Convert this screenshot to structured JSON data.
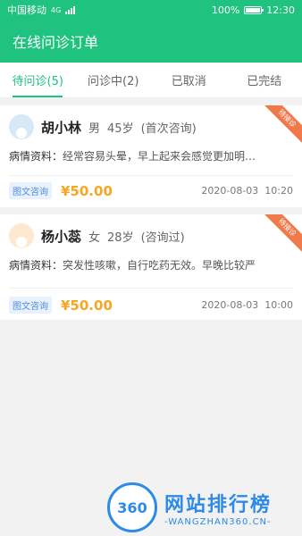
{
  "statusbar": {
    "carrier": "中国移动",
    "network": "4G",
    "battery": "100%",
    "time": "12:30"
  },
  "navbar": {
    "title": "在线问诊订单"
  },
  "tabs": [
    {
      "label": "待问诊(5)",
      "active": true
    },
    {
      "label": "问诊中(2)",
      "active": false
    },
    {
      "label": "已取消",
      "active": false
    },
    {
      "label": "已完结",
      "active": false
    }
  ],
  "orders": [
    {
      "name": "胡小林",
      "gender": "男",
      "age": "45岁",
      "consult_type": "(首次咨询)",
      "badge": "待接诊",
      "desc_label": "病情资料：",
      "desc": "经常容易头晕，早上起来会感觉更加明…",
      "tag": "图文咨询",
      "price": "¥50.00",
      "date": "2020-08-03",
      "time": "10:20"
    },
    {
      "name": "杨小蕊",
      "gender": "女",
      "age": "28岁",
      "consult_type": "(咨询过)",
      "badge": "待接诊",
      "desc_label": "病情资料：",
      "desc": "突发性咳嗽，自行吃药无效。早晚比较严",
      "tag": "图文咨询",
      "price": "¥50.00",
      "date": "2020-08-03",
      "time": "10:00"
    }
  ],
  "watermark": {
    "logo_text": "360",
    "main": "网站排行榜",
    "sub": "-WANGZHAN360.CN-"
  },
  "colors": {
    "primary": "#1fc27e",
    "price": "#f5a623",
    "badge": "#f07a4b",
    "tag": "#4a90e2"
  }
}
